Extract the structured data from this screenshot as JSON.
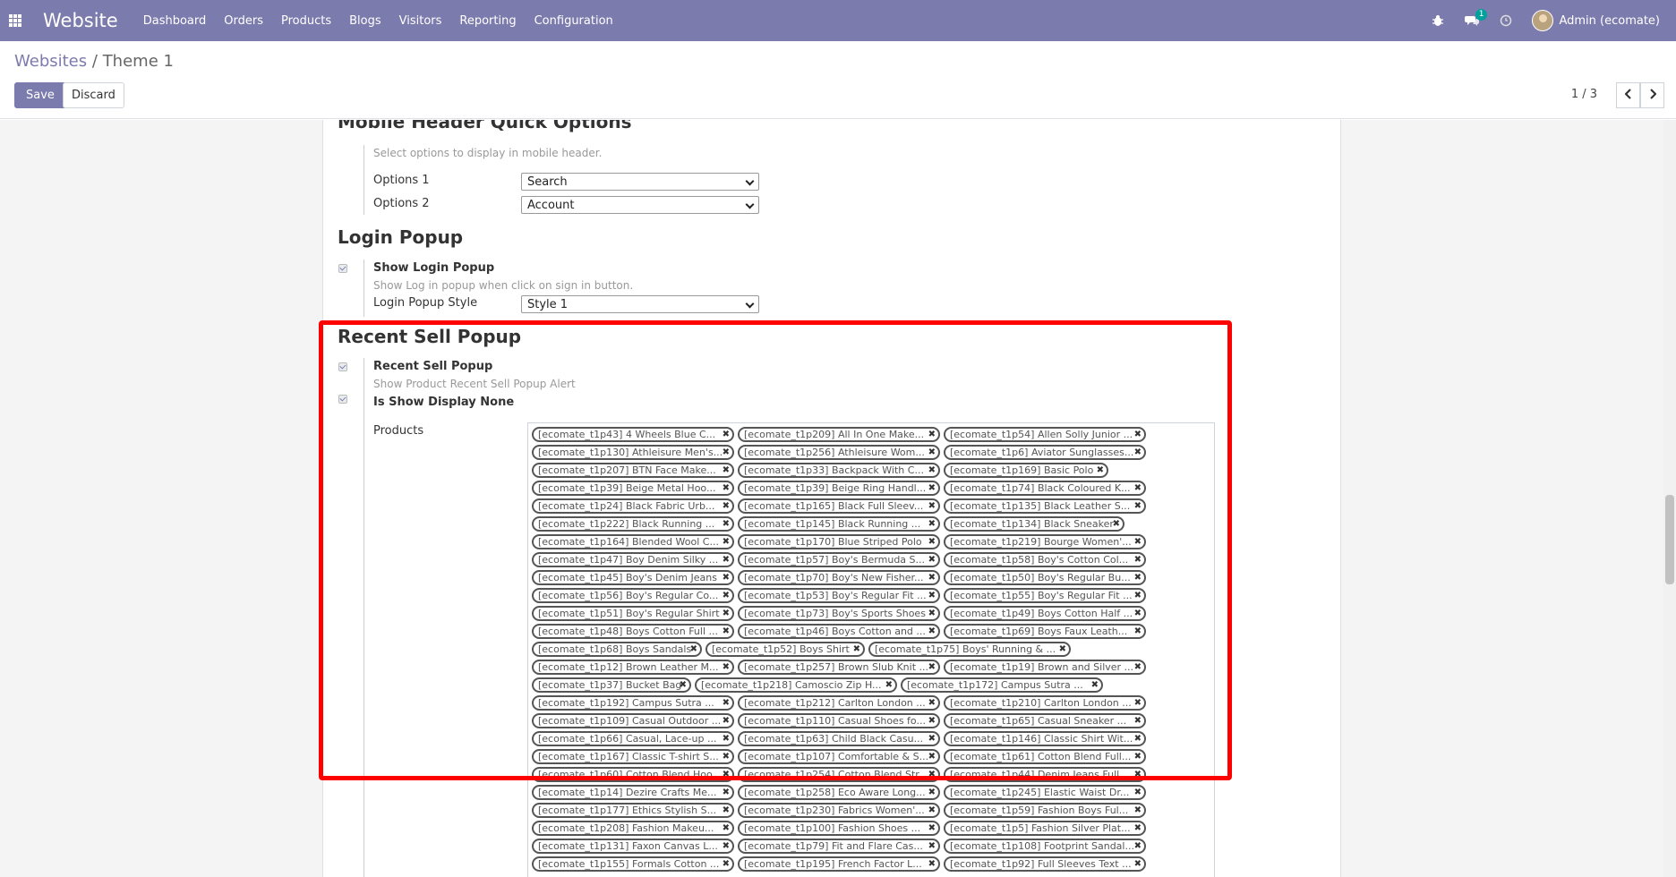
{
  "navbar": {
    "app_name": "Website",
    "menu": [
      "Dashboard",
      "Orders",
      "Products",
      "Blogs",
      "Visitors",
      "Reporting",
      "Configuration"
    ],
    "messages_count": "1",
    "user": "Admin (ecomate)"
  },
  "breadcrumb": {
    "parent": "Websites",
    "separator": "/",
    "current": "Theme 1"
  },
  "actions": {
    "save": "Save",
    "discard": "Discard"
  },
  "pager": {
    "text": "1 / 3"
  },
  "mobile_header": {
    "title": "Mobile Header Quick Options",
    "help": "Select options to display in mobile header.",
    "option1_label": "Options 1",
    "option1_value": "Search",
    "option2_label": "Options 2",
    "option2_value": "Account"
  },
  "login_popup": {
    "title": "Login Popup",
    "checkbox_label": "Show Login Popup",
    "checked": true,
    "help": "Show Log in popup when click on sign in button.",
    "style_label": "Login Popup Style",
    "style_value": "Style 1"
  },
  "recent_sell": {
    "title": "Recent Sell Popup",
    "checkbox_label": "Recent Sell Popup",
    "checked": true,
    "help": "Show Product Recent Sell Popup Alert",
    "display_none_label": "Is Show Display None",
    "display_none_checked": true,
    "products_label": "Products",
    "products": [
      [
        "[ecomate_t1p43] 4 Wheels Blue C...",
        "[ecomate_t1p209] All In One Make...",
        "[ecomate_t1p54] Allen Solly Junior ..."
      ],
      [
        "[ecomate_t1p130] Athleisure Men's...",
        "[ecomate_t1p256] Athleisure Wom...",
        "[ecomate_t1p6] Aviator Sunglasses..."
      ],
      [
        "[ecomate_t1p207] BTN Face Make...",
        "[ecomate_t1p33] Backpack With C...",
        "[ecomate_t1p169] Basic Polo"
      ],
      [
        "[ecomate_t1p39] Beige Metal Hoo...",
        "[ecomate_t1p39] Beige Ring Handl...",
        "[ecomate_t1p74] Black Coloured K..."
      ],
      [
        "[ecomate_t1p24] Black Fabric Urb...",
        "[ecomate_t1p165] Black Full Sleev...",
        "[ecomate_t1p135] Black Leather S..."
      ],
      [
        "[ecomate_t1p222] Black Running ...",
        "[ecomate_t1p145] Black Running ...",
        "[ecomate_t1p134] Black Sneaker"
      ],
      [
        "[ecomate_t1p164] Blended Wool C...",
        "[ecomate_t1p170] Blue Striped Polo",
        "[ecomate_t1p219] Bourge Women'..."
      ],
      [
        "[ecomate_t1p47] Boy Denim Silky ...",
        "[ecomate_t1p57] Boy's Bermuda S...",
        "[ecomate_t1p58] Boy's Cotton Col..."
      ],
      [
        "[ecomate_t1p45] Boy's Denim Jeans",
        "[ecomate_t1p70] Boy's New Fisher...",
        "[ecomate_t1p50] Boy's Regular Bu..."
      ],
      [
        "[ecomate_t1p56] Boy's Regular Co...",
        "[ecomate_t1p53] Boy's Regular Fit ...",
        "[ecomate_t1p55] Boy's Regular Fit ..."
      ],
      [
        "[ecomate_t1p51] Boy's Regular Shirt",
        "[ecomate_t1p73] Boy's Sports Shoes",
        "[ecomate_t1p49] Boys Cotton Half ..."
      ],
      [
        "[ecomate_t1p48] Boys Cotton Full ...",
        "[ecomate_t1p46] Boys Cotton and ...",
        "[ecomate_t1p69] Boys Faux Leath..."
      ],
      [
        "[ecomate_t1p68] Boys Sandals",
        "[ecomate_t1p52] Boys Shirt",
        "[ecomate_t1p75] Boys' Running & ..."
      ],
      [
        "[ecomate_t1p12] Brown Leather M...",
        "[ecomate_t1p257] Brown Slub Knit ...",
        "[ecomate_t1p19] Brown and Silver ..."
      ],
      [
        "[ecomate_t1p37] Bucket Bag",
        "[ecomate_t1p218] Camoscio Zip H...",
        "[ecomate_t1p172] Campus Sutra ..."
      ],
      [
        "[ecomate_t1p192] Campus Sutra ...",
        "[ecomate_t1p212] Carlton London ...",
        "[ecomate_t1p210] Carlton London ..."
      ],
      [
        "[ecomate_t1p109] Casual Outdoor ...",
        "[ecomate_t1p110] Casual Shoes fo...",
        "[ecomate_t1p65] Casual Sneaker ..."
      ],
      [
        "[ecomate_t1p66] Casual, Lace-up ...",
        "[ecomate_t1p63] Child Black Casu...",
        "[ecomate_t1p146] Classic Shirt Wit..."
      ],
      [
        "[ecomate_t1p167] Classic T-shirt S...",
        "[ecomate_t1p107] Comfortable & S...",
        "[ecomate_t1p61] Cotton Blend Full..."
      ],
      [
        "[ecomate_t1p60] Cotton Blend Hoo...",
        "[ecomate_t1p254] Cotton Blend Str...",
        "[ecomate_t1p44] Denim Jeans Full..."
      ],
      [
        "[ecomate_t1p14] Dezire Crafts Me...",
        "[ecomate_t1p258] Eco Aware Long...",
        "[ecomate_t1p245] Elastic Waist Dr..."
      ],
      [
        "[ecomate_t1p177] Ethics Stylish S...",
        "[ecomate_t1p230] Fabrics Women'...",
        "[ecomate_t1p59] Fashion Boys Ful..."
      ],
      [
        "[ecomate_t1p208] Fashion Makeu...",
        "[ecomate_t1p100] Fashion Shoes ...",
        "[ecomate_t1p5] Fashion Silver Plat..."
      ],
      [
        "[ecomate_t1p131] Faxon Canvas L...",
        "[ecomate_t1p79] Fit and Flare Cas...",
        "[ecomate_t1p108] Footprint Sandal..."
      ],
      [
        "[ecomate_t1p155] Formals Cotton ...",
        "[ecomate_t1p195] French Factor L...",
        "[ecomate_t1p92] Full Sleeves Text ..."
      ]
    ]
  }
}
